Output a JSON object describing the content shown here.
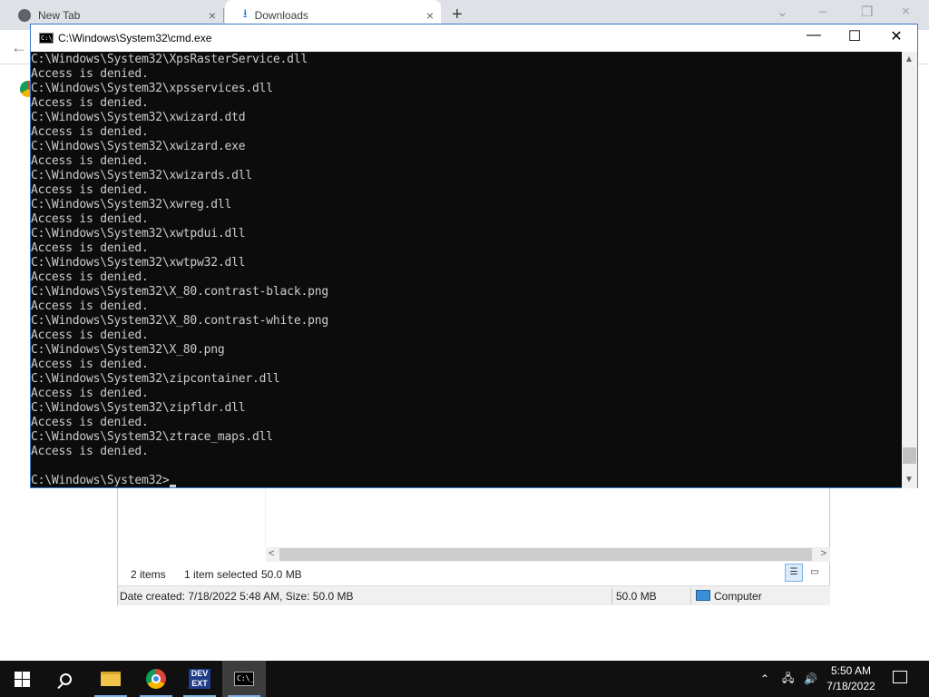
{
  "browser": {
    "tabs": [
      {
        "label": "New Tab"
      },
      {
        "label": "Downloads"
      }
    ],
    "icons": {
      "close": "×",
      "plus": "+",
      "minimize": "–",
      "restore": "❐",
      "chevron": "⌄",
      "back": "←"
    }
  },
  "explorer": {
    "status_items": "2 items",
    "status_selected": "1 item selected",
    "status_size": "50.0 MB",
    "details_created": "Date created: 7/18/2022 5:48 AM, Size: 50.0 MB",
    "details_size": "50.0 MB",
    "details_location": "Computer",
    "scroll_left": "<",
    "scroll_right": ">"
  },
  "cmd": {
    "title": "C:\\Windows\\System32\\cmd.exe",
    "icon_text": "C:\\_",
    "controls": {
      "minimize": "—",
      "maximize": "☐",
      "close": "✕"
    },
    "lines": [
      "C:\\Windows\\System32\\XpsRasterService.dll",
      "Access is denied.",
      "C:\\Windows\\System32\\xpsservices.dll",
      "Access is denied.",
      "C:\\Windows\\System32\\xwizard.dtd",
      "Access is denied.",
      "C:\\Windows\\System32\\xwizard.exe",
      "Access is denied.",
      "C:\\Windows\\System32\\xwizards.dll",
      "Access is denied.",
      "C:\\Windows\\System32\\xwreg.dll",
      "Access is denied.",
      "C:\\Windows\\System32\\xwtpdui.dll",
      "Access is denied.",
      "C:\\Windows\\System32\\xwtpw32.dll",
      "Access is denied.",
      "C:\\Windows\\System32\\X_80.contrast-black.png",
      "Access is denied.",
      "C:\\Windows\\System32\\X_80.contrast-white.png",
      "Access is denied.",
      "C:\\Windows\\System32\\X_80.png",
      "Access is denied.",
      "C:\\Windows\\System32\\zipcontainer.dll",
      "Access is denied.",
      "C:\\Windows\\System32\\zipfldr.dll",
      "Access is denied.",
      "C:\\Windows\\System32\\ztrace_maps.dll",
      "Access is denied.",
      ""
    ],
    "prompt": "C:\\Windows\\System32>"
  },
  "taskbar": {
    "dev_label_1": "DEV",
    "dev_label_2": "EXT",
    "cmd_icon_text": "C:\\_",
    "time": "5:50 AM",
    "date": "7/18/2022",
    "tray_chevron": "⌃",
    "network_icon": "🖧",
    "volume_icon": "🔊"
  }
}
